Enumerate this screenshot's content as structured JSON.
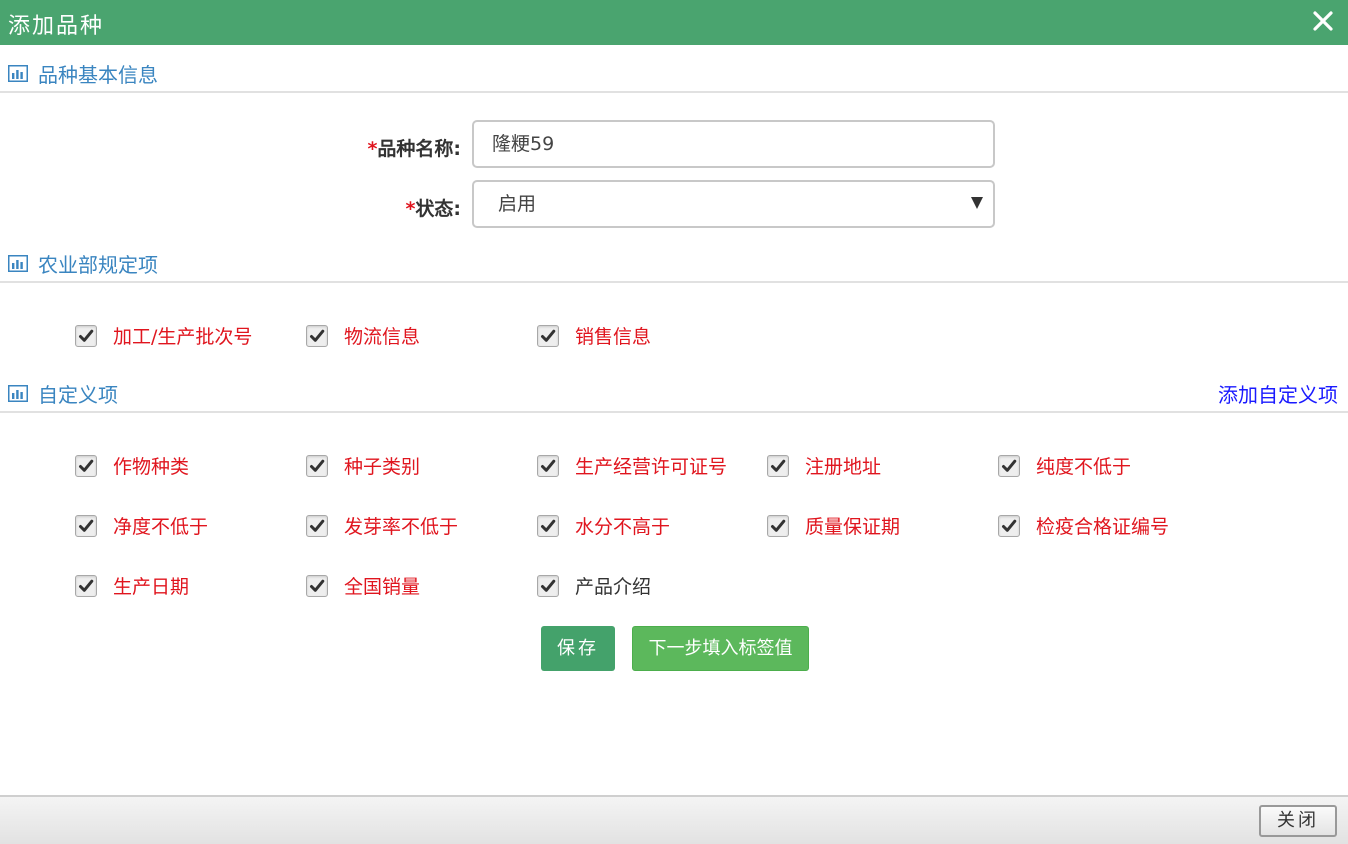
{
  "dialog": {
    "title": "添加品种"
  },
  "sections": {
    "basic": "品种基本信息",
    "ministry": "农业部规定项",
    "custom": "自定义项",
    "add_custom_link": "添加自定义项"
  },
  "form": {
    "required_mark": "*",
    "name_label": "品种名称:",
    "name_value": "隆粳59",
    "status_label": "状态:",
    "status_value": "启用"
  },
  "ministry_items": [
    {
      "label": "加工/生产批次号",
      "checked": true
    },
    {
      "label": "物流信息",
      "checked": true
    },
    {
      "label": "销售信息",
      "checked": true
    }
  ],
  "custom_items": [
    {
      "label": "作物种类",
      "checked": true
    },
    {
      "label": "种子类别",
      "checked": true
    },
    {
      "label": "生产经营许可证号",
      "checked": true
    },
    {
      "label": "注册地址",
      "checked": true
    },
    {
      "label": "纯度不低于",
      "checked": true
    },
    {
      "label": "净度不低于",
      "checked": true
    },
    {
      "label": "发芽率不低于",
      "checked": true
    },
    {
      "label": "水分不高于",
      "checked": true
    },
    {
      "label": "质量保证期",
      "checked": true
    },
    {
      "label": "检疫合格证编号",
      "checked": true
    },
    {
      "label": "生产日期",
      "checked": true
    },
    {
      "label": "全国销量",
      "checked": true
    },
    {
      "label": "产品介绍",
      "checked": true
    }
  ],
  "buttons": {
    "save": "保存",
    "next": "下一步填入标签值",
    "close": "关闭"
  },
  "colors": {
    "header_green": "#4aa46f",
    "section_blue": "#3a85c0",
    "required_red": "#e0151e",
    "link_blue": "#1a1aff"
  }
}
